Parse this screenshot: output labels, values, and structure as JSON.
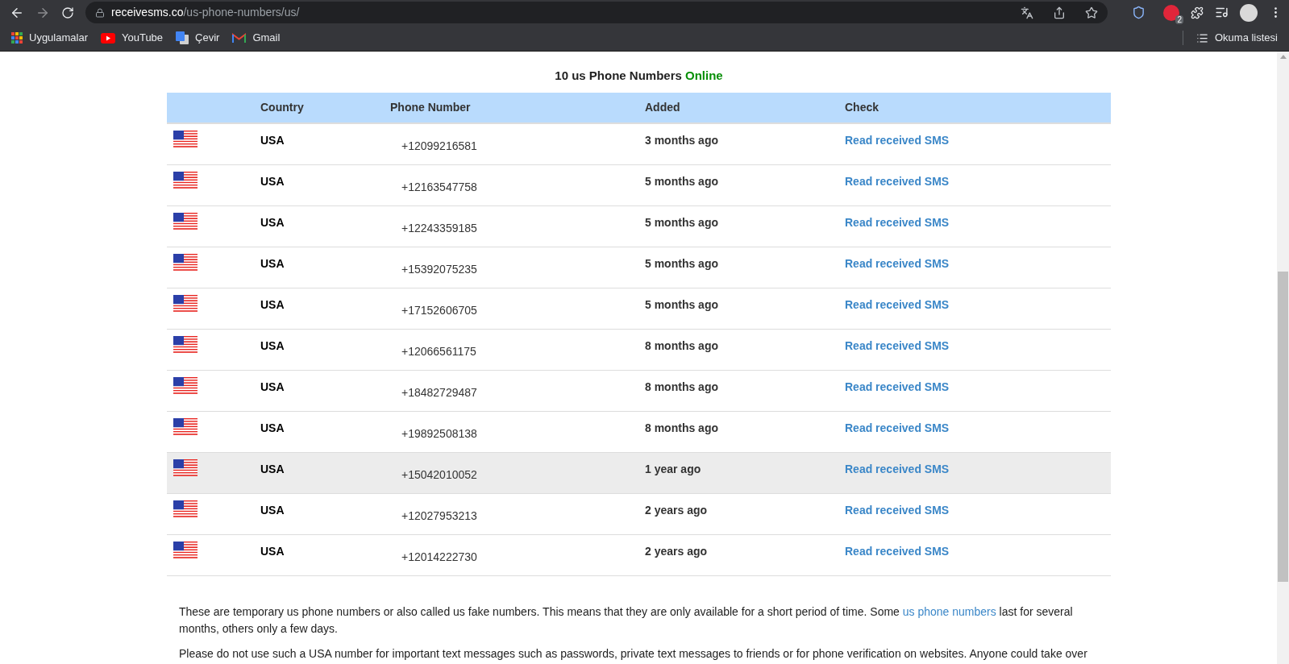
{
  "browser": {
    "url_host": "receivesms.co",
    "url_path": "/us-phone-numbers/us/",
    "extension_badge": "2",
    "bookmarks": [
      {
        "label": "Uygulamalar",
        "kind": "apps"
      },
      {
        "label": "YouTube",
        "kind": "youtube"
      },
      {
        "label": "Çevir",
        "kind": "translate"
      },
      {
        "label": "Gmail",
        "kind": "gmail"
      }
    ],
    "reading_list": "Okuma listesi"
  },
  "heading": {
    "text": "10 us Phone Numbers",
    "status": "Online"
  },
  "table": {
    "columns": [
      "Country",
      "Phone Number",
      "Added",
      "Check"
    ],
    "rows": [
      {
        "country": "USA",
        "phone": "+12099216581",
        "added": "3 months ago",
        "check": "Read received SMS",
        "hovered": false
      },
      {
        "country": "USA",
        "phone": "+12163547758",
        "added": "5 months ago",
        "check": "Read received SMS",
        "hovered": false
      },
      {
        "country": "USA",
        "phone": "+12243359185",
        "added": "5 months ago",
        "check": "Read received SMS",
        "hovered": false
      },
      {
        "country": "USA",
        "phone": "+15392075235",
        "added": "5 months ago",
        "check": "Read received SMS",
        "hovered": false
      },
      {
        "country": "USA",
        "phone": "+17152606705",
        "added": "5 months ago",
        "check": "Read received SMS",
        "hovered": false
      },
      {
        "country": "USA",
        "phone": "+12066561175",
        "added": "8 months ago",
        "check": "Read received SMS",
        "hovered": false
      },
      {
        "country": "USA",
        "phone": "+18482729487",
        "added": "8 months ago",
        "check": "Read received SMS",
        "hovered": false
      },
      {
        "country": "USA",
        "phone": "+19892508138",
        "added": "8 months ago",
        "check": "Read received SMS",
        "hovered": false
      },
      {
        "country": "USA",
        "phone": "+15042010052",
        "added": "1 year ago",
        "check": "Read received SMS",
        "hovered": true
      },
      {
        "country": "USA",
        "phone": "+12027953213",
        "added": "2 years ago",
        "check": "Read received SMS",
        "hovered": false
      },
      {
        "country": "USA",
        "phone": "+12014222730",
        "added": "2 years ago",
        "check": "Read received SMS",
        "hovered": false
      }
    ]
  },
  "paragraphs": [
    [
      {
        "kind": "text",
        "text": "These are temporary us phone numbers or also called us fake numbers. This means that they are only available for a short period of time. Some "
      },
      {
        "kind": "link",
        "text": "us phone numbers"
      },
      {
        "kind": "text",
        "text": " last for several months, others only a few days."
      }
    ],
    [
      {
        "kind": "text",
        "text": "Please do not use such a USA number for important text messages such as passwords, private text messages to friends or for phone verification on websites. Anyone could take over"
      }
    ]
  ]
}
